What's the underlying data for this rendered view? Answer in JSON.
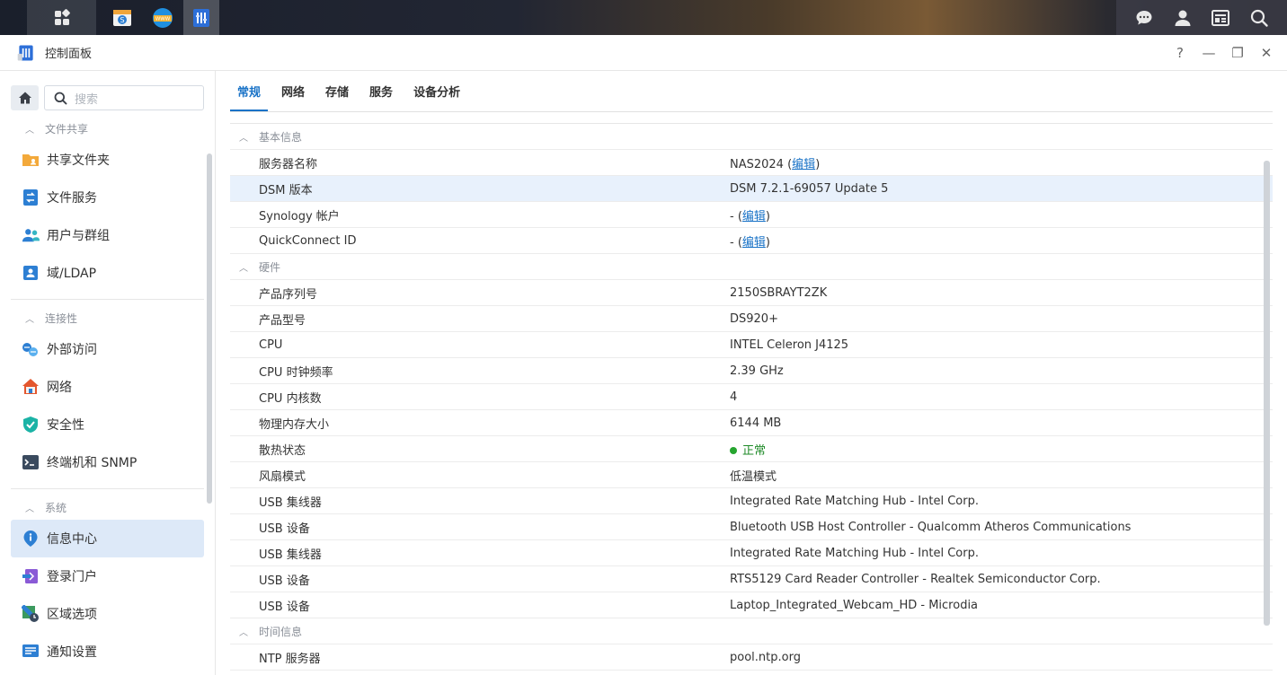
{
  "window": {
    "title": "控制面板",
    "help": "?",
    "minimize": "—",
    "restore": "❐",
    "close": "✕"
  },
  "search": {
    "placeholder": "搜索"
  },
  "sidebar": {
    "sections": [
      {
        "label": "文件共享",
        "items": [
          "共享文件夹",
          "文件服务",
          "用户与群组",
          "域/LDAP"
        ]
      },
      {
        "label": "连接性",
        "items": [
          "外部访问",
          "网络",
          "安全性",
          "终端机和 SNMP"
        ]
      },
      {
        "label": "系统",
        "items": [
          "信息中心",
          "登录门户",
          "区域选项",
          "通知设置"
        ]
      }
    ]
  },
  "tabs": [
    "常规",
    "网络",
    "存储",
    "服务",
    "设备分析"
  ],
  "groups": {
    "basic": "基本信息",
    "hardware": "硬件",
    "time": "时间信息"
  },
  "rows": {
    "server_name": {
      "k": "服务器名称",
      "v": "NAS2024 (",
      "link": "编辑",
      "tail": ")"
    },
    "dsm": {
      "k": "DSM 版本",
      "v": "DSM 7.2.1-69057 Update 5"
    },
    "synology": {
      "k": "Synology 帐户",
      "v": "- (",
      "link": "编辑",
      "tail": ")"
    },
    "quickconnect": {
      "k": "QuickConnect ID",
      "v": "- (",
      "link": "编辑",
      "tail": ")"
    },
    "serial": {
      "k": "产品序列号",
      "v": "2150SBRAYT2ZK"
    },
    "model": {
      "k": "产品型号",
      "v": "DS920+"
    },
    "cpu": {
      "k": "CPU",
      "v": "INTEL Celeron J4125"
    },
    "cpu_clock": {
      "k": "CPU 时钟频率",
      "v": "2.39 GHz"
    },
    "cpu_cores": {
      "k": "CPU 内核数",
      "v": "4"
    },
    "memory": {
      "k": "物理内存大小",
      "v": "6144 MB"
    },
    "thermal": {
      "k": "散热状态",
      "v": "正常"
    },
    "fan": {
      "k": "风扇模式",
      "v": "低温模式"
    },
    "usb1": {
      "k": "USB 集线器",
      "v": "Integrated Rate Matching Hub - Intel Corp."
    },
    "usb2": {
      "k": "USB 设备",
      "v": "Bluetooth USB Host Controller - Qualcomm Atheros Communications"
    },
    "usb3": {
      "k": "USB 集线器",
      "v": "Integrated Rate Matching Hub - Intel Corp."
    },
    "usb4": {
      "k": "USB 设备",
      "v": "RTS5129 Card Reader Controller - Realtek Semiconductor Corp."
    },
    "usb5": {
      "k": "USB 设备",
      "v": "Laptop_Integrated_Webcam_HD - Microdia"
    },
    "ntp": {
      "k": "NTP 服务器",
      "v": "pool.ntp.org"
    }
  },
  "colors": {
    "accent": "#1a73c7",
    "ok": "#26a52f",
    "selected_row": "#e8f1fc",
    "active_nav": "#dde9f8"
  }
}
